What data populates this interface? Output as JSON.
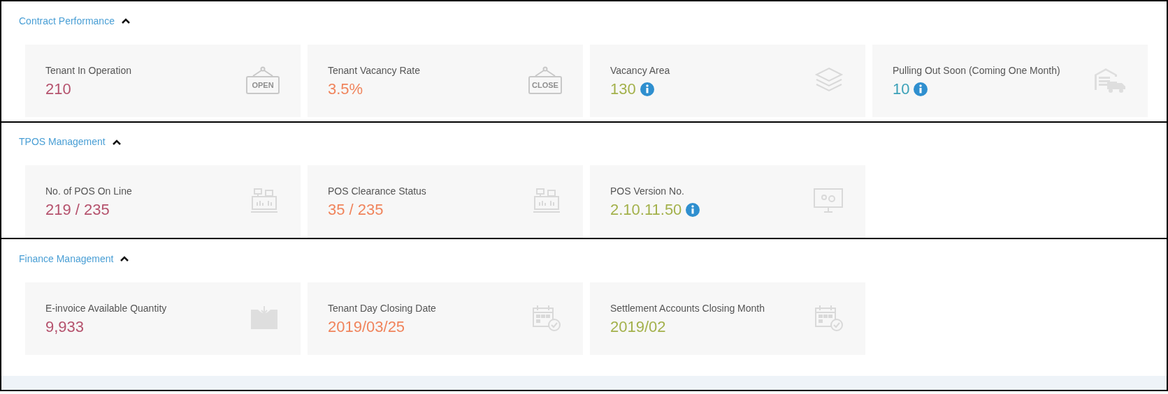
{
  "sections": [
    {
      "title": "Contract Performance",
      "expanded": true,
      "cards": [
        {
          "label": "Tenant In Operation",
          "value": "210",
          "color": "#b5526d",
          "info": false,
          "kind": "sign",
          "sign_text": "OPEN"
        },
        {
          "label": "Tenant Vacancy Rate",
          "value": "3.5%",
          "color": "#f0845c",
          "info": false,
          "kind": "sign",
          "sign_text": "CLOSE"
        },
        {
          "label": "Vacancy Area",
          "value": "130",
          "color": "#a3b14b",
          "info": true,
          "kind": "layers"
        },
        {
          "label": "Pulling Out Soon (Coming One Month)",
          "value": "10",
          "color": "#3ba1b8",
          "info": true,
          "kind": "truck"
        }
      ]
    },
    {
      "title": "TPOS Management",
      "expanded": true,
      "cards": [
        {
          "label": "No. of POS On Line",
          "value": "219 / 235",
          "color": "#b5526d",
          "info": false,
          "kind": "register"
        },
        {
          "label": "POS Clearance Status",
          "value": "35 / 235",
          "color": "#f0845c",
          "info": false,
          "kind": "register"
        },
        {
          "label": "POS Version No.",
          "value": "2.10.11.50",
          "color": "#a3b14b",
          "info": true,
          "kind": "monitor"
        }
      ]
    },
    {
      "title": "Finance Management",
      "expanded": true,
      "cards": [
        {
          "label": "E-invoice Available Quantity",
          "value": "9,933",
          "color": "#b5526d",
          "info": false,
          "kind": "inbox"
        },
        {
          "label": "Tenant Day Closing Date",
          "value": "2019/03/25",
          "color": "#f0845c",
          "info": false,
          "kind": "calendar"
        },
        {
          "label": "Settlement Accounts Closing Month",
          "value": "2019/02",
          "color": "#a3b14b",
          "info": false,
          "kind": "calendar"
        }
      ]
    }
  ]
}
